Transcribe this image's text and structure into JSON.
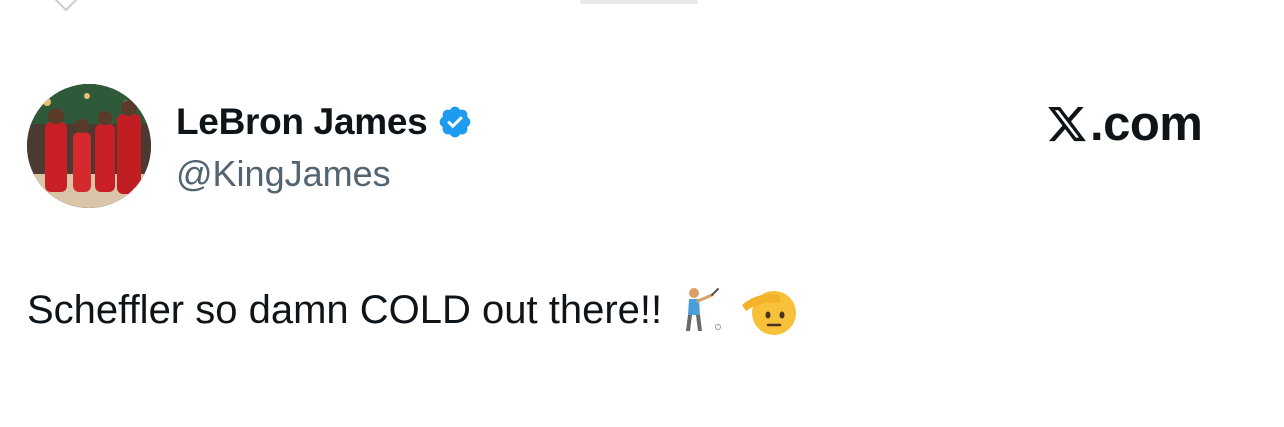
{
  "user": {
    "display_name": "LeBron James",
    "handle": "@KingJames",
    "verified": true,
    "avatar_icon": "profile-photo"
  },
  "brand": {
    "site": ".com",
    "logo_icon": "x-logo"
  },
  "tweet": {
    "text": "Scheffler so damn COLD out there!!",
    "emojis": [
      "golfer-emoji",
      "saluting-face-emoji"
    ]
  },
  "colors": {
    "text_primary": "#0f1419",
    "text_secondary": "#536471",
    "verified_blue": "#1d9bf0"
  }
}
